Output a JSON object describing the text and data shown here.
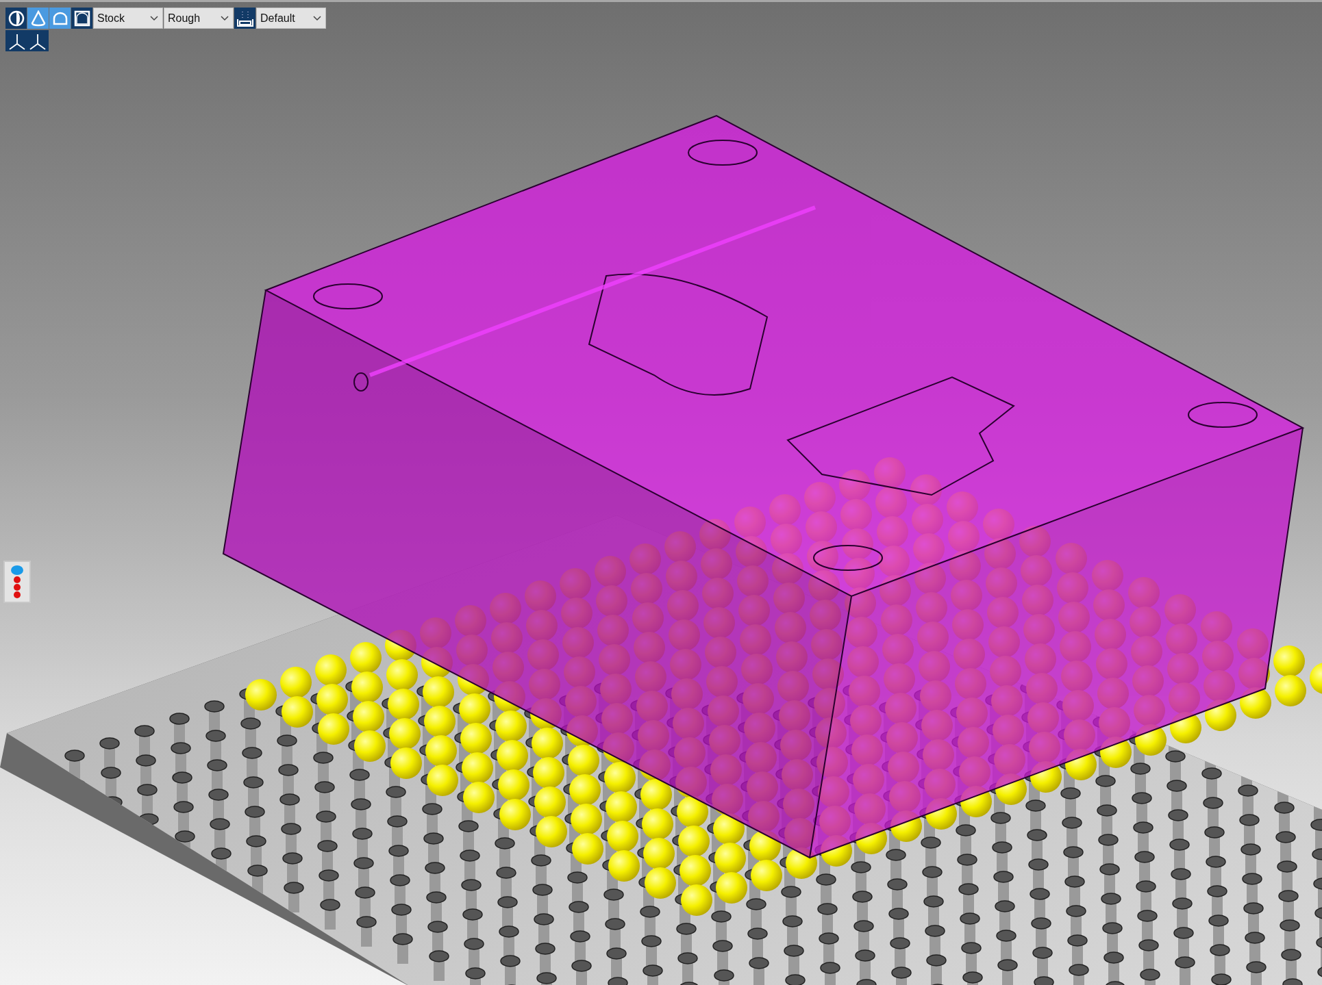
{
  "toolbar": {
    "items": [
      {
        "kind": "toggle",
        "selected": false
      },
      {
        "kind": "toggle",
        "selected": true
      },
      {
        "kind": "toggle",
        "selected": true
      },
      {
        "kind": "toggle",
        "selected": false
      },
      {
        "kind": "dropdown",
        "value": "Stock"
      },
      {
        "kind": "dropdown",
        "value": "Rough"
      },
      {
        "kind": "toggle",
        "selected": false
      },
      {
        "kind": "dropdown",
        "value": "Default"
      }
    ]
  },
  "axes_button": {
    "selected": false
  }
}
